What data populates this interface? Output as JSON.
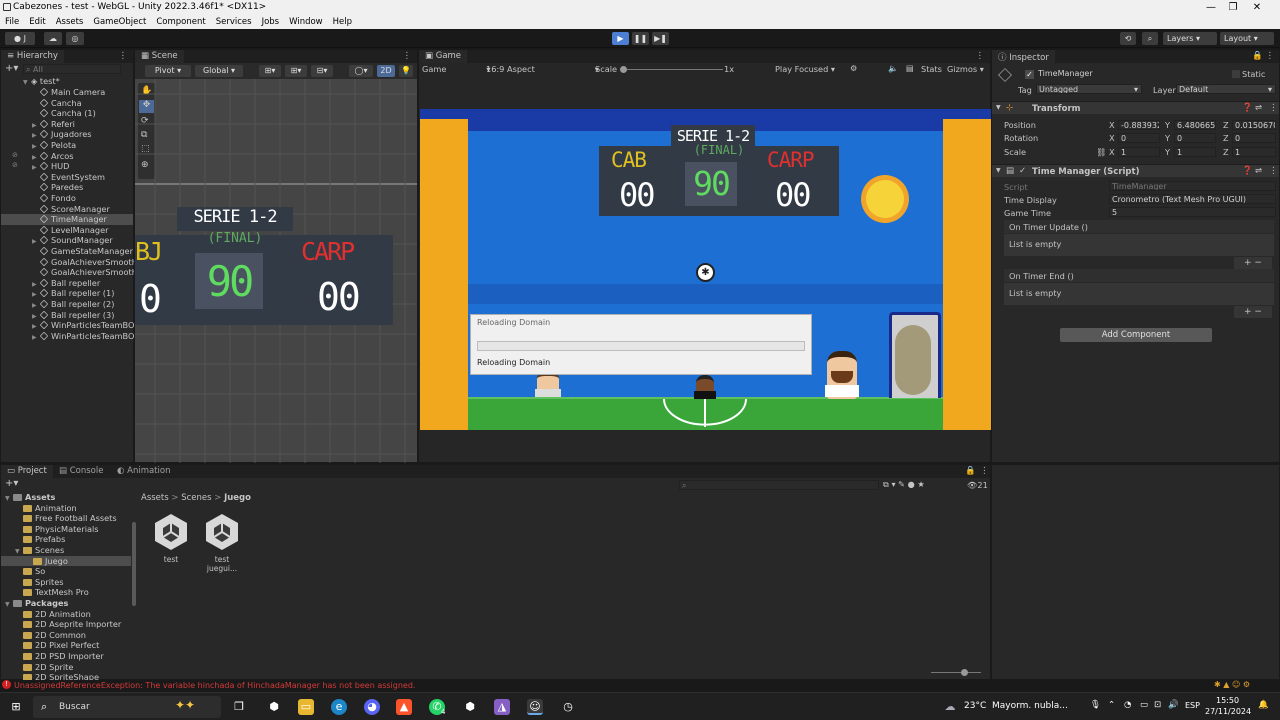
{
  "window": {
    "title": "Cabezones - test - WebGL - Unity 2022.3.46f1* <DX11>",
    "min": "—",
    "max": "❐",
    "close": "✕"
  },
  "menu": [
    "File",
    "Edit",
    "Assets",
    "GameObject",
    "Component",
    "Services",
    "Jobs",
    "Window",
    "Help"
  ],
  "toolbar": {
    "account": "J",
    "layers": "Layers",
    "layout": "Layout"
  },
  "hierarchy": {
    "tab": "Hierarchy",
    "search_placeholder": "All",
    "scene": "test*",
    "items": [
      "Main Camera",
      "Cancha",
      "Cancha (1)",
      "Referi",
      "Jugadores",
      "Pelota",
      "Arcos",
      "HUD",
      "EventSystem",
      "Paredes",
      "Fondo",
      "ScoreManager",
      "TimeManager",
      "LevelManager",
      "SoundManager",
      "GameStateManager",
      "GoalAchieverSmooth",
      "GoalAchieverSmooth",
      "Ball repeller",
      "Ball repeller (1)",
      "Ball repeller (2)",
      "Ball repeller (3)",
      "WinParticlesTeamBO",
      "WinParticlesTeamBO"
    ],
    "selected": 12
  },
  "scene_view": {
    "tab": "Scene",
    "pivot": "Pivot",
    "global": "Global",
    "mode_2d": "2D"
  },
  "game_view": {
    "tab": "Game",
    "display": "Game",
    "aspect": "16:9 Aspect",
    "scale_label": "Scale",
    "scale_value": "1x",
    "play_mode": "Play Focused",
    "stats": "Stats",
    "gizmos": "Gizmos",
    "scoreboard": {
      "series": "SERIE 1-2",
      "status": "(FINAL)",
      "team_left": "CAB",
      "team_right": "CARP",
      "score_left": "00",
      "time": "90",
      "score_right": "00"
    },
    "scene_partial": {
      "left_team": "BJ"
    },
    "dialog": {
      "title": "Reloading Domain",
      "status": "Reloading Domain",
      "progress": 0
    }
  },
  "inspector": {
    "tab": "Inspector",
    "object_name": "TimeManager",
    "static_label": "Static",
    "tag_label": "Tag",
    "tag_value": "Untagged",
    "layer_label": "Layer",
    "layer_value": "Default",
    "transform": {
      "title": "Transform",
      "position_label": "Position",
      "px": "-0.883932",
      "py": "6.480665",
      "pz": "0.0150670",
      "rotation_label": "Rotation",
      "rx": "0",
      "ry": "0",
      "rz": "0",
      "scale_label": "Scale",
      "sx": "1",
      "sy": "1",
      "sz": "1"
    },
    "script": {
      "title": "Time Manager (Script)",
      "script_label": "Script",
      "script_value": "TimeManager",
      "display_label": "Time Display",
      "display_value": "Cronometro (Text Mesh Pro UGUI)",
      "gametime_label": "Game Time",
      "gametime_value": "5",
      "on_update": "On Timer Update ()",
      "on_end": "On Timer End ()",
      "empty": "List is empty"
    },
    "add_component": "Add Component"
  },
  "project": {
    "tabs": [
      "Project",
      "Console",
      "Animation"
    ],
    "tree": [
      {
        "label": "Assets",
        "level": 0,
        "bold": true
      },
      {
        "label": "Animation",
        "level": 1
      },
      {
        "label": "Free Football Assets",
        "level": 1
      },
      {
        "label": "PhysicMaterials",
        "level": 1
      },
      {
        "label": "Prefabs",
        "level": 1
      },
      {
        "label": "Scenes",
        "level": 1
      },
      {
        "label": "Juego",
        "level": 2
      },
      {
        "label": "So",
        "level": 1
      },
      {
        "label": "Sprites",
        "level": 1
      },
      {
        "label": "TextMesh Pro",
        "level": 1
      },
      {
        "label": "Packages",
        "level": 0,
        "bold": true
      },
      {
        "label": "2D Animation",
        "level": 1
      },
      {
        "label": "2D Aseprite Importer",
        "level": 1
      },
      {
        "label": "2D Common",
        "level": 1
      },
      {
        "label": "2D Pixel Perfect",
        "level": 1
      },
      {
        "label": "2D PSD Importer",
        "level": 1
      },
      {
        "label": "2D Sprite",
        "level": 1
      },
      {
        "label": "2D SpriteShape",
        "level": 1
      }
    ],
    "breadcrumb": [
      "Assets",
      "Scenes",
      "Juego"
    ],
    "files": [
      "test",
      "test juegui..."
    ],
    "count": "21"
  },
  "status_error": "UnassignedReferenceException: The variable hinchada of HinchadaManager has not been assigned.",
  "taskbar": {
    "search": "Buscar",
    "weather_temp": "23°C",
    "weather_text": "Mayorm. nubla...",
    "lang": "ESP",
    "time": "15:50",
    "date": "27/11/2024",
    "notif": "4"
  },
  "colors": {
    "accent": "#4c7fd1",
    "sky": "#1e6fd4",
    "pitch": "#3aa63a",
    "wall": "#f2a81e",
    "scoreboard": "#323a45"
  }
}
